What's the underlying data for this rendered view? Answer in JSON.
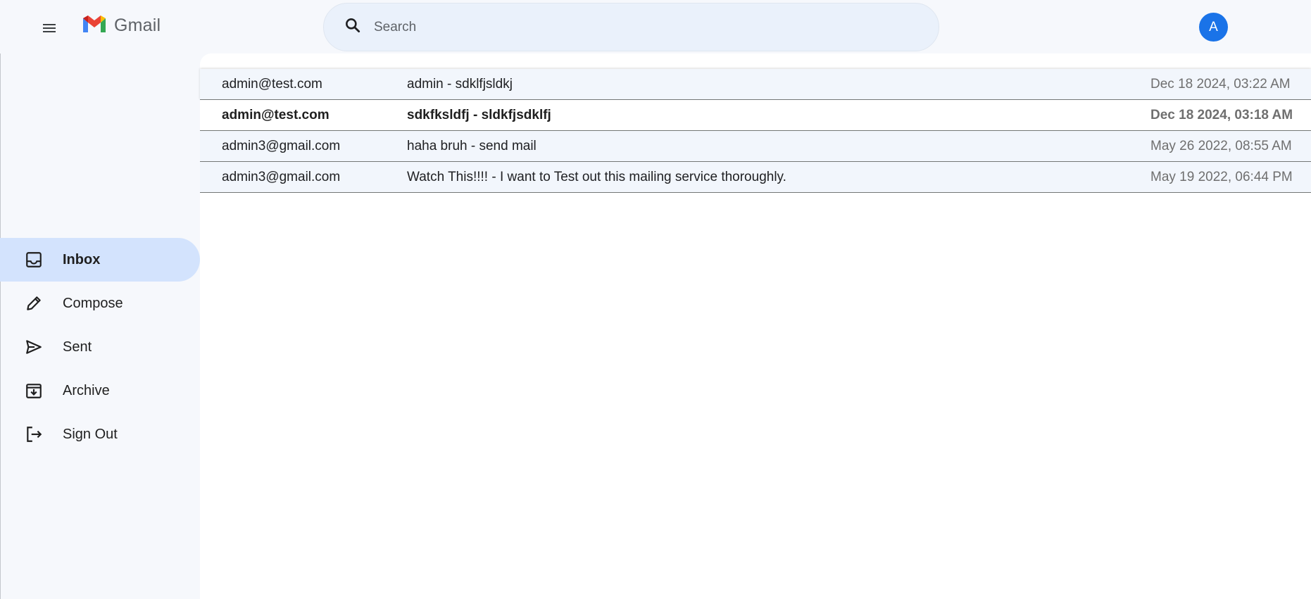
{
  "header": {
    "app_name": "Gmail",
    "search_placeholder": "Search",
    "avatar_initial": "A"
  },
  "sidebar": {
    "items": [
      {
        "label": "Inbox",
        "icon": "inbox-icon",
        "active": true
      },
      {
        "label": "Compose",
        "icon": "pencil-icon",
        "active": false
      },
      {
        "label": "Sent",
        "icon": "send-icon",
        "active": false
      },
      {
        "label": "Archive",
        "icon": "archive-icon",
        "active": false
      },
      {
        "label": "Sign Out",
        "icon": "logout-icon",
        "active": false
      }
    ]
  },
  "emails": [
    {
      "from": "admin@test.com",
      "subject": "admin - sdklfjsldkj",
      "date": "Dec 18 2024, 03:22 AM",
      "unread": false
    },
    {
      "from": "admin@test.com",
      "subject": "sdkfksldfj - sldkfjsdklfj",
      "date": "Dec 18 2024, 03:18 AM",
      "unread": true
    },
    {
      "from": "admin3@gmail.com",
      "subject": "haha bruh - send mail",
      "date": "May 26 2022, 08:55 AM",
      "unread": false
    },
    {
      "from": "admin3@gmail.com",
      "subject": "Watch This!!!! - I want to Test out this mailing service thoroughly.",
      "date": "May 19 2022, 06:44 PM",
      "unread": false
    }
  ],
  "colors": {
    "accent": "#1a73e8",
    "active_nav": "#d3e3fd",
    "search_bg": "#eaf1fb",
    "page_bg": "#f6f8fc",
    "row_read_bg": "#f2f6fc"
  }
}
